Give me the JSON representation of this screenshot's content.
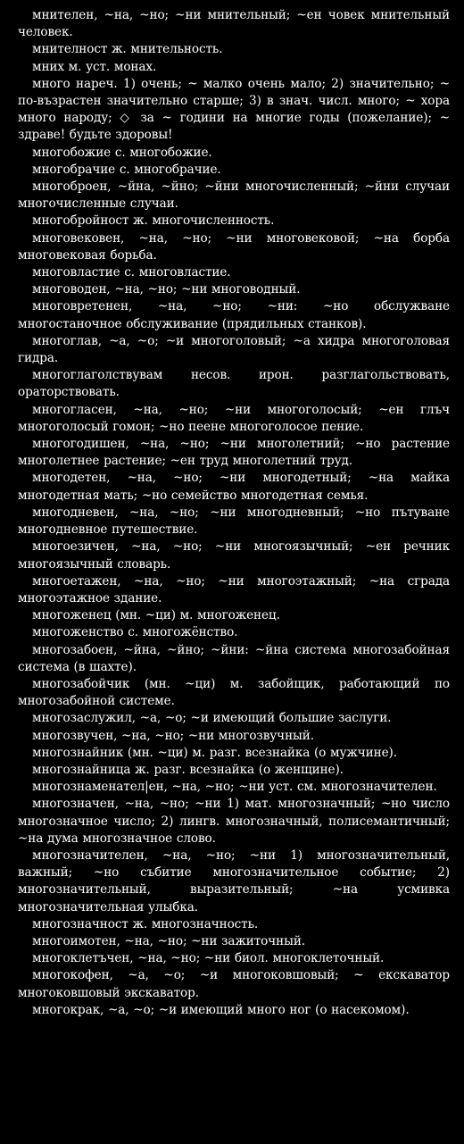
{
  "entries": [
    "мнителен, ~на, ~но; ~ни мнительный; ~ен човек мнительный человек.",
    "мнителност ж. мнительность.",
    "мних м. уст. монах.",
    "много нареч. 1) очень; ~ малко очень мало; 2) значительно; ~ по-възрастен значительно старше; 3) в знач. числ. много; ~ хора много народу; ◇ за ~ години на многие годы (пожелание); ~ здраве! будьте здоровы!",
    "многобожие с. многобожие.",
    "многобрачие с. многобрачие.",
    "многоброен, ~йна, ~йно; ~йни многочисленный; ~йни случаи многочисленные случаи.",
    "многобройност ж. многочисленность.",
    "многовековен, ~на, ~но; ~ни многовековой; ~на борба многовековая борьба.",
    "многовластие с. многовластие.",
    "многоводен, ~на, ~но; ~ни многоводный.",
    "многовретенен, ~на, ~но; ~ни: ~но обслужване многостаночное обслуживание (прядильных станков).",
    "многоглав, ~а, ~о; ~и многоголовый; ~а хидра многоголовая гидра.",
    "многоглаголствувам несов. ирон. разглагольствовать, ораторствовать.",
    "многогласен, ~на, ~но; ~ни многоголосый; ~ен глъч многоголосый гомон; ~но пеене многоголосое пение.",
    "многогодишен, ~на, ~но; ~ни многолетний; ~но растение многолетнее растение; ~ен труд многолетний труд.",
    "многодетен, ~на, ~но; ~ни многодетный; ~на майка многодетная мать; ~но семейство многодетная семья.",
    "многодневен, ~на, ~но; ~ни многодневный; ~но пътуване многодневное путешествие.",
    "многоезичен, ~на, ~но; ~ни многоязычный; ~ен речник многоязычный словарь.",
    "многоетажен, ~на, ~но; ~ни многоэтажный; ~на сграда многоэтажное здание.",
    "многоженец (мн. ~ци) м. многоженец.",
    "многоженство с. многожёнство.",
    "многозабоен, ~йна, ~йно; ~йни: ~йна система многозабойная система (в шахте).",
    "многозабойчик (мн. ~ци) м. забойщик, работающий по многозабойной системе.",
    "многозаслужил, ~а, ~о; ~и имеющий большие заслуги.",
    "многозвучен, ~на, ~но; ~ни многозвучный.",
    "многознайник (мн. ~ци) м. разг. всезнайка (о мужчине).",
    "многознайница ж. разг. всезнайка (о женщине).",
    "многознаменател|ен, ~на, ~но; ~ни уст. см. многозначителен.",
    "многозначен, ~на, ~но; ~ни 1) мат. многозначный; ~но число многозначное число; 2) лингв. многозначный, полисемантичный; ~на дума многозначное слово.",
    "многозначителен, ~на, ~но; ~ни 1) многозначительный, важный; ~но събитие многозначительное событие; 2) многозначительный, выразительный; ~на усмивка многозначительная улыбка.",
    "многозначност ж. многозначность.",
    "многоимотен, ~на, ~но; ~ни зажиточный.",
    "многоклетъчен, ~на, ~но; ~ни биол. многоклеточный.",
    "многокофен, ~а, ~о; ~и многоковшовый; ~ екскаватор многоковшовый экскаватор.",
    "многокрак, ~а, ~о; ~и имеющий много ног (о насекомом)."
  ]
}
